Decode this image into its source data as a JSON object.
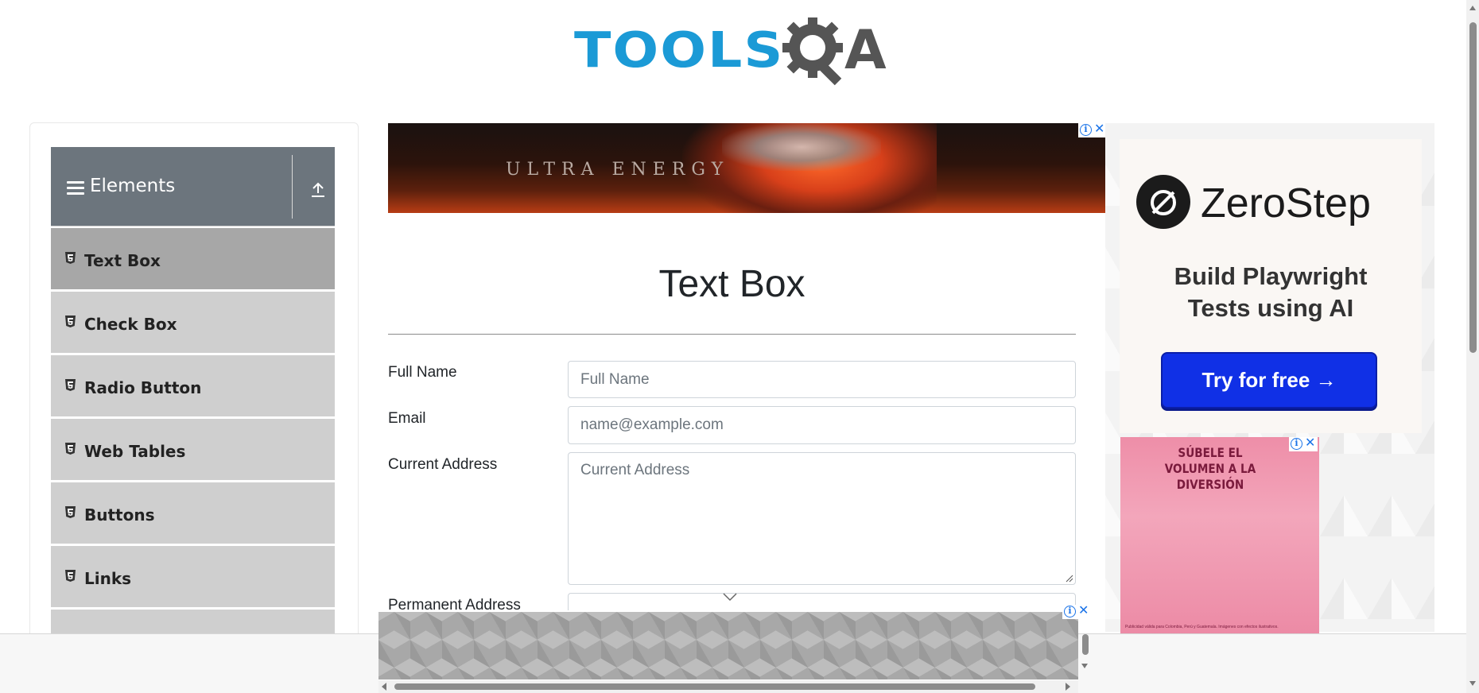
{
  "header": {
    "logo_primary": "TOOLS",
    "logo_secondary": "A"
  },
  "sidebar": {
    "group_title": "Elements",
    "items": [
      {
        "label": "Text Box",
        "active": true
      },
      {
        "label": "Check Box",
        "active": false
      },
      {
        "label": "Radio Button",
        "active": false
      },
      {
        "label": "Web Tables",
        "active": false
      },
      {
        "label": "Buttons",
        "active": false
      },
      {
        "label": "Links",
        "active": false
      }
    ]
  },
  "top_ad": {
    "tagline": "ULTRA ENERGY"
  },
  "main": {
    "title": "Text Box",
    "fields": [
      {
        "label": "Full Name",
        "placeholder": "Full Name"
      },
      {
        "label": "Email",
        "placeholder": "name@example.com"
      },
      {
        "label": "Current Address",
        "placeholder": "Current Address"
      },
      {
        "label": "Permanent Address",
        "placeholder": ""
      }
    ]
  },
  "right_ad": {
    "brand": "ZeroStep",
    "tagline_line1": "Build Playwright",
    "tagline_line2": "Tests using AI",
    "cta": "Try for free →"
  },
  "pink_ad": {
    "headline": "SÚBELE EL VOLUMEN A LA DIVERSIÓN",
    "fine_print": "Publicidad válida para Colombia, Perú y Guatemala. Imágenes con efectos ilustrativos."
  },
  "colors": {
    "brand_blue": "#1b9ad6",
    "group_header": "#6c757d",
    "menu_item": "#cfcfcf",
    "menu_item_active": "#a7a7a7",
    "cta_blue": "#1030e6"
  }
}
